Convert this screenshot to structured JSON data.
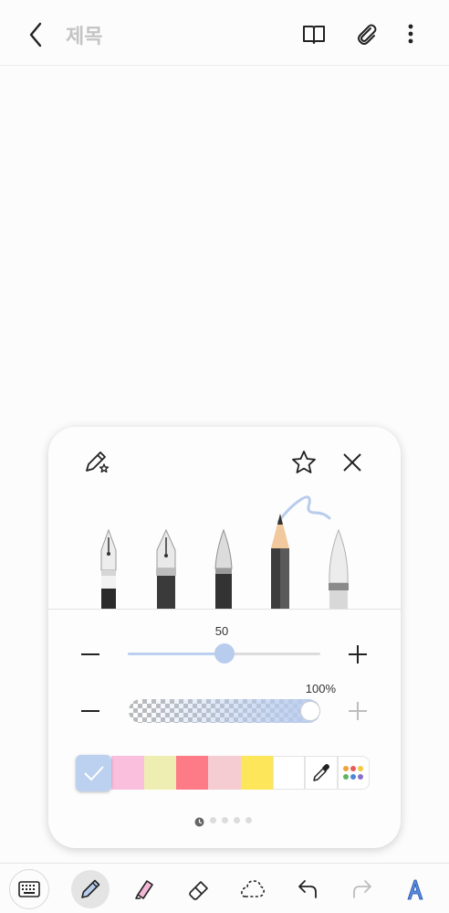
{
  "header": {
    "title": "제목"
  },
  "pen_panel": {
    "pens": [
      "fountain-pen",
      "calligraphy-pen",
      "brush-pen",
      "pencil",
      "marker"
    ],
    "selected_pen": "pencil",
    "size": {
      "value_label": "50",
      "fraction": 0.5
    },
    "opacity": {
      "value_label": "100%",
      "fraction": 1.0
    },
    "colors": [
      "#bcd0ef",
      "#f9bfdd",
      "#eeeeb2",
      "#fd7b86",
      "#f4ccd1",
      "#fde65a",
      "#ffffff"
    ],
    "selected_color": "#bcd0ef",
    "page_indicator": {
      "count": 5,
      "current": 1
    }
  },
  "bottom_toolbar": {
    "items": [
      "keyboard-icon",
      "pen-icon",
      "highlighter-icon",
      "eraser-icon",
      "lasso-icon",
      "undo-icon",
      "redo-icon",
      "text-style-icon"
    ],
    "active": "pen-icon"
  }
}
